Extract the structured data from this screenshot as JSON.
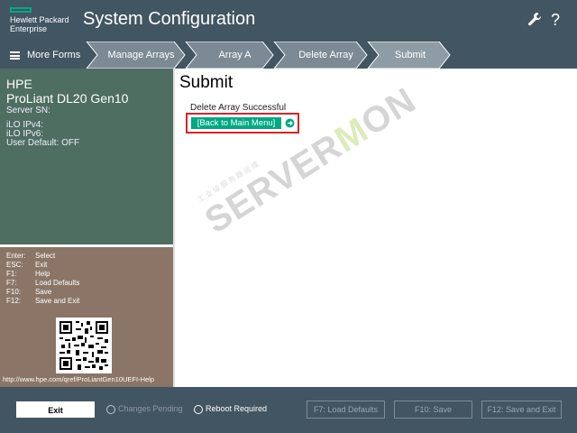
{
  "header": {
    "brand_line1": "Hewlett Packard",
    "brand_line2": "Enterprise",
    "title": "System Configuration",
    "icons": [
      "wrench-icon",
      "help-icon"
    ],
    "help_glyph": "?"
  },
  "nav": {
    "more_forms_label": "More Forms",
    "crumbs": [
      "Manage Arrays",
      "Array A",
      "Delete Array",
      "Submit"
    ]
  },
  "system_info": {
    "vendor": "HPE",
    "model": "ProLiant DL20 Gen10",
    "serial_label": "Server SN:",
    "ilo_ipv4_label": "iLO IPv4:",
    "ilo_ipv6_label": "iLO IPv6:",
    "user_default": "User Default: OFF"
  },
  "shortcuts": [
    {
      "key": "Enter:",
      "action": "Select"
    },
    {
      "key": "ESC:",
      "action": "Exit"
    },
    {
      "key": "F1:",
      "action": "Help"
    },
    {
      "key": "F7:",
      "action": "Load Defaults"
    },
    {
      "key": "F10:",
      "action": "Save"
    },
    {
      "key": "F12:",
      "action": "Save and Exit"
    }
  ],
  "help_url": "http://www.hpe.com/qref/ProLiantGen10UEFI-Help",
  "main": {
    "title": "Submit",
    "status": "Delete Array Successful",
    "back_link": "[Back to Main Menu]"
  },
  "watermark": {
    "text_before": "SERVER",
    "text_o": "M",
    "text_after": "ON",
    "subtitle": "工业级服务器运维"
  },
  "footer": {
    "exit_label": "Exit",
    "changes_pending": "Changes Pending",
    "reboot_required": "Reboot Required",
    "f7_label": "F7: Load Defaults",
    "f10_label": "F10: Save",
    "f12_label": "F12: Save and Exit"
  },
  "colors": {
    "header_bg": "#425563",
    "accent_green": "#01a982",
    "left_top_bg": "#4e6e61",
    "left_bottom_bg": "#8b7567",
    "highlight_red": "#d9232a"
  }
}
